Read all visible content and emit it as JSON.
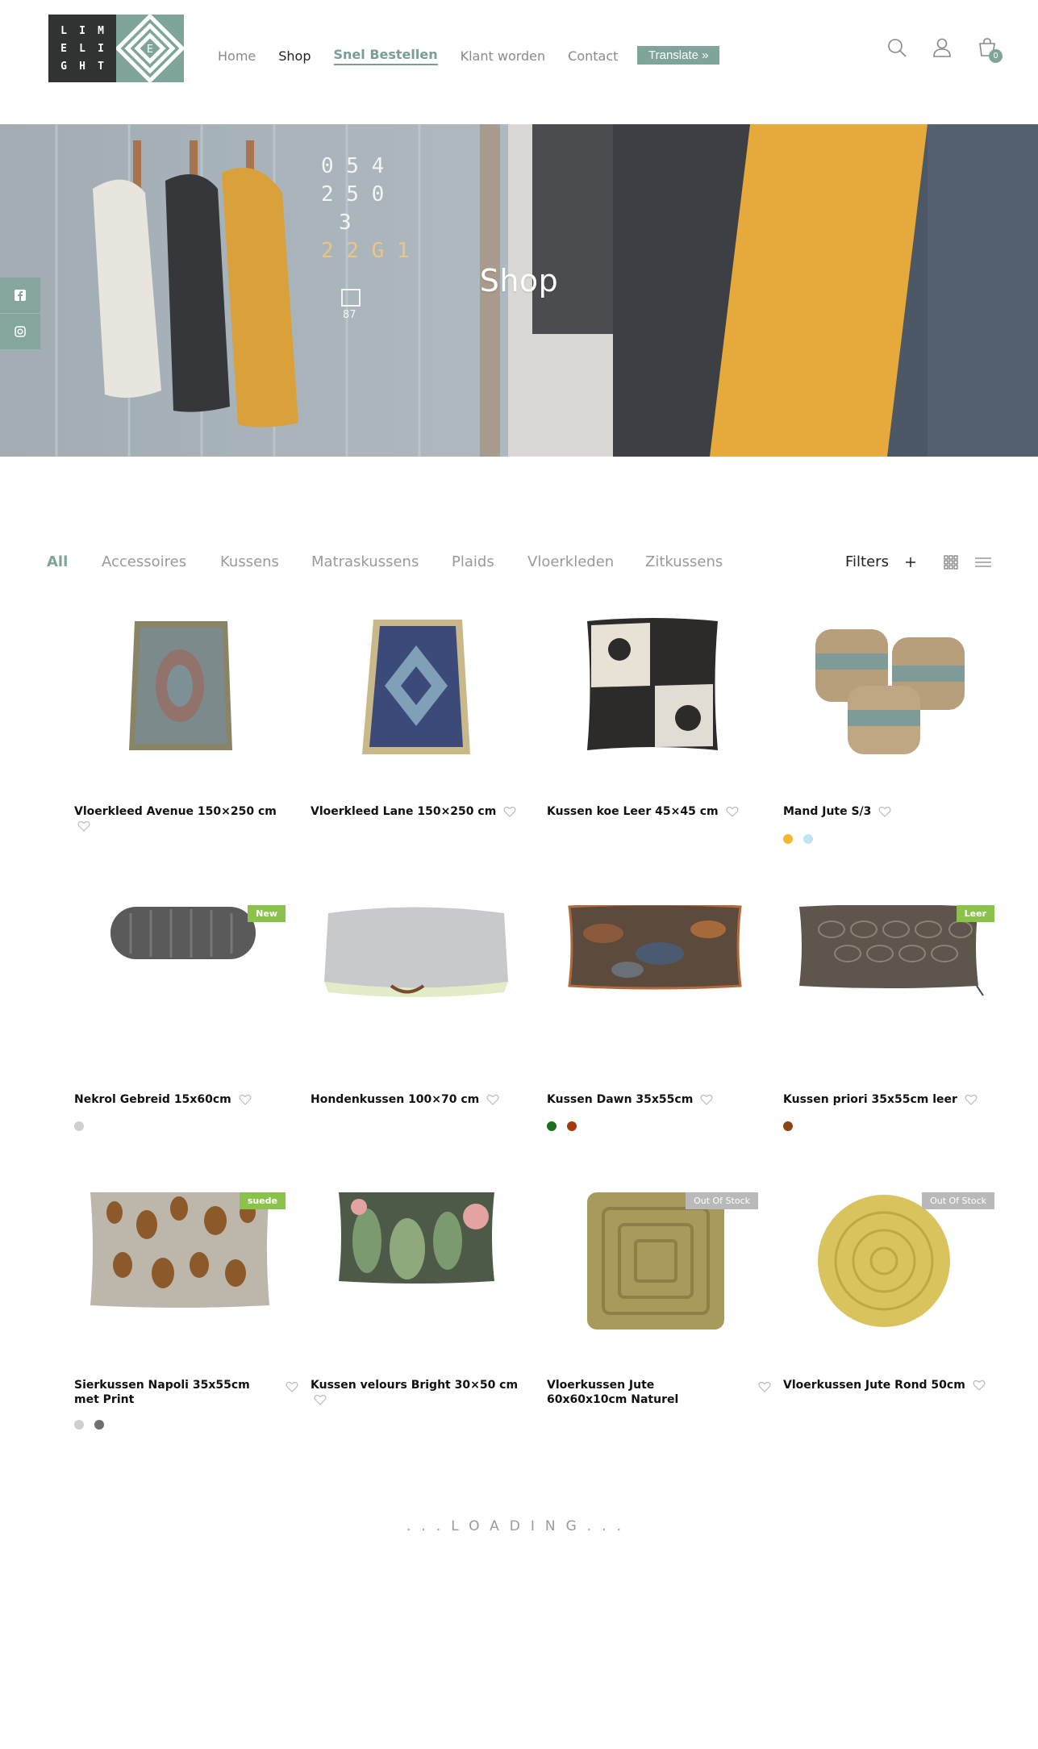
{
  "logo": {
    "letters": [
      [
        "L",
        "I",
        "M"
      ],
      [
        "E",
        "L",
        "I"
      ],
      [
        "G",
        "H",
        "T"
      ]
    ]
  },
  "nav": {
    "items": [
      {
        "label": "Home",
        "state": "normal"
      },
      {
        "label": "Shop",
        "state": "active"
      },
      {
        "label": "Snel Bestellen",
        "state": "current"
      },
      {
        "label": "Klant worden",
        "state": "normal"
      },
      {
        "label": "Contact",
        "state": "normal"
      }
    ],
    "translate_label": "Translate »"
  },
  "header_icons": {
    "search": "search-icon",
    "account": "user-icon",
    "cart": "cart-icon",
    "cart_count": "0"
  },
  "hero": {
    "title": "Shop",
    "social": [
      "facebook-icon",
      "instagram-icon"
    ]
  },
  "categories": [
    "All",
    "Accessoires",
    "Kussens",
    "Matraskussens",
    "Plaids",
    "Vloerkleden",
    "Zitkussens"
  ],
  "filters_label": "Filters",
  "products": [
    {
      "name": "Vloerkleed Avenue 150×250 cm",
      "badge": "",
      "swatches": []
    },
    {
      "name": "Vloerkleed Lane 150×250 cm",
      "badge": "",
      "swatches": []
    },
    {
      "name": "Kussen koe Leer 45×45 cm",
      "badge": "",
      "swatches": []
    },
    {
      "name": "Mand Jute S/3",
      "badge": "",
      "swatches": [
        "#f2b731",
        "#bfe6f0"
      ]
    },
    {
      "name": "Nekrol Gebreid 15x60cm",
      "badge": "New",
      "swatches": [
        "#cfcfcf"
      ]
    },
    {
      "name": "Hondenkussen 100×70 cm",
      "badge": "",
      "swatches": []
    },
    {
      "name": "Kussen Dawn 35x55cm",
      "badge": "",
      "swatches": [
        "#1b6f1f",
        "#a3390f"
      ]
    },
    {
      "name": "Kussen priori 35x55cm leer",
      "badge": "Leer",
      "swatches": [
        "#8b4513"
      ]
    },
    {
      "name": "Sierkussen Napoli 35x55cm met Print",
      "badge": "suede",
      "swatches": [
        "#cfcfcf",
        "#6e6e6e"
      ]
    },
    {
      "name": "Kussen velours Bright 30×50 cm",
      "badge": "",
      "swatches": []
    },
    {
      "name": "Vloerkussen Jute 60x60x10cm Naturel",
      "badge": "Out Of Stock",
      "swatches": []
    },
    {
      "name": "Vloerkussen Jute Rond 50cm",
      "badge": "Out Of Stock",
      "swatches": []
    }
  ],
  "loading_text": "...LOADING...",
  "colors": {
    "accent": "#7fa49a",
    "badge_green": "#8bc34a",
    "badge_grey": "#b9b9b9"
  }
}
